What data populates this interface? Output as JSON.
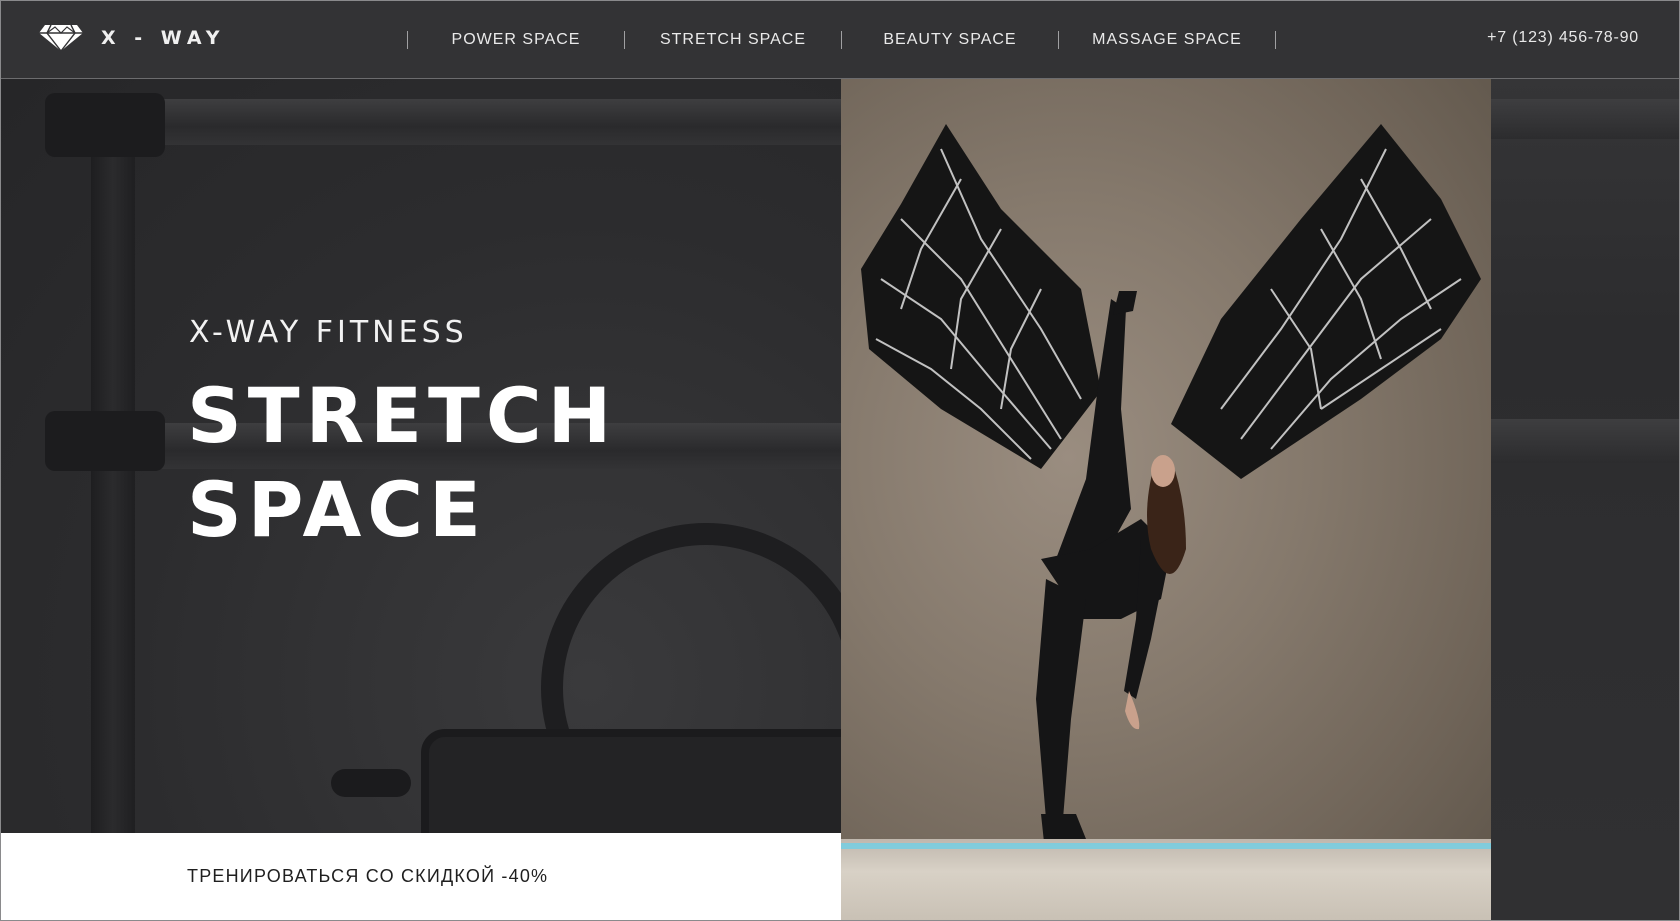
{
  "header": {
    "brand": "X - WAY",
    "logo_icon": "diamond-logo-icon",
    "nav": [
      "POWER SPACE",
      "STRETCH SPACE",
      "BEAUTY SPACE",
      "MASSAGE SPACE"
    ],
    "phone": "+7 (123) 456-78-90"
  },
  "hero": {
    "subtitle": "X-WAY FITNESS",
    "title_line1": "STRETCH",
    "title_line2": "SPACE",
    "cta": "ТРЕНИРОВАТЬСЯ СО СКИДКОЙ -40%"
  },
  "colors": {
    "background": "#2e2e30",
    "header": "#333335",
    "text": "#ffffff",
    "cta_bg": "#ffffff",
    "cta_text": "#1f1f1f",
    "floor_light": "#6fd0e6"
  }
}
